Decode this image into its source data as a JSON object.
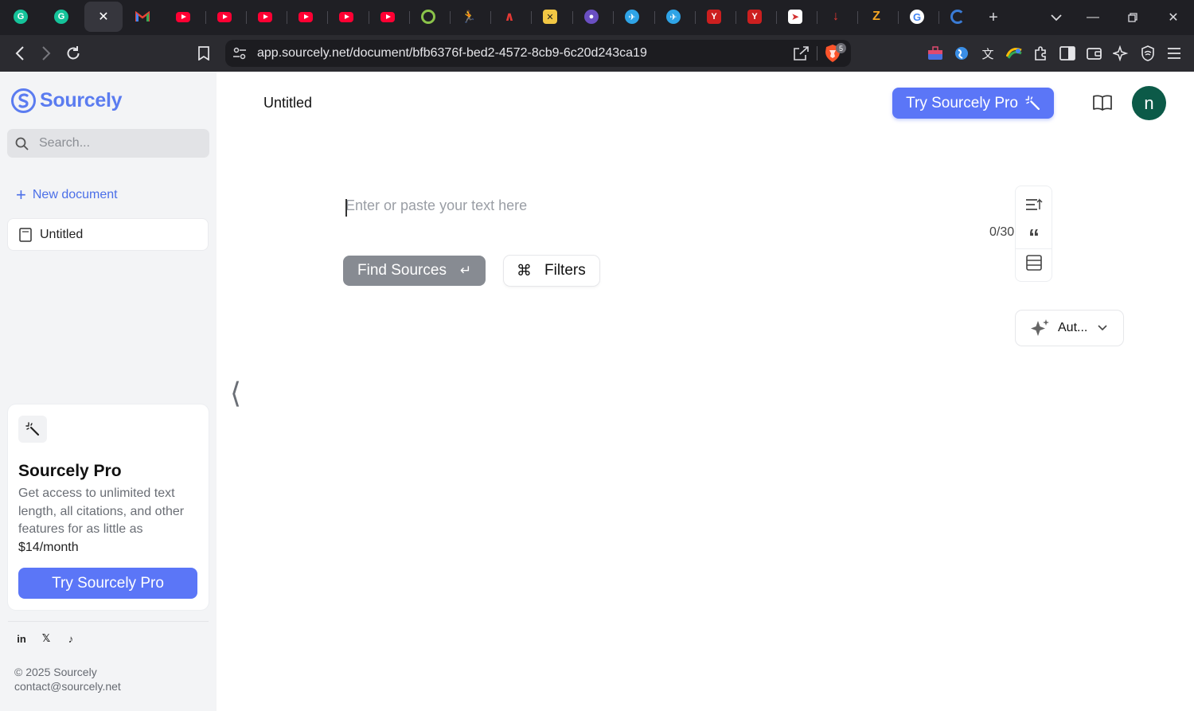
{
  "browser": {
    "url": "app.sourcely.net/document/bfb6376f-bed2-4572-8cb9-6c20d243ca19",
    "shields_count": "5",
    "tabs": [
      {
        "icon": "grammarly-icon"
      },
      {
        "icon": "grammarly-icon"
      },
      {
        "icon": "close-icon",
        "active": true
      },
      {
        "icon": "gmail-icon"
      },
      {
        "icon": "youtube-icon"
      },
      {
        "icon": "youtube-icon"
      },
      {
        "icon": "youtube-icon"
      },
      {
        "icon": "youtube-icon"
      },
      {
        "icon": "youtube-icon"
      },
      {
        "icon": "youtube-icon"
      },
      {
        "icon": "ring-icon"
      },
      {
        "icon": "runner-icon"
      },
      {
        "icon": "pen-icon"
      },
      {
        "icon": "puzzle-app-icon"
      },
      {
        "icon": "globe-icon"
      },
      {
        "icon": "bird-icon"
      },
      {
        "icon": "bird-icon"
      },
      {
        "icon": "yale-icon"
      },
      {
        "icon": "yale-icon"
      },
      {
        "icon": "bird-red-icon"
      },
      {
        "icon": "download-arrow-icon"
      },
      {
        "icon": "z-icon"
      },
      {
        "icon": "google-icon"
      },
      {
        "icon": "edge-icon"
      }
    ],
    "colors": {
      "tabstrip": "#1f1f24",
      "toolbar": "#2b2b30",
      "youtube": "#ff0033"
    }
  },
  "sidebar": {
    "brand": "Sourcely",
    "search_placeholder": "Search...",
    "new_document": "New document",
    "documents": [
      "Untitled"
    ],
    "pro_card": {
      "title": "Sourcely Pro",
      "description": "Get access to unlimited text length, all citations, and other features for as little as",
      "price": "$14/month",
      "button": "Try Sourcely Pro"
    },
    "socials": [
      {
        "label": "in",
        "icon": "linkedin-icon"
      },
      {
        "label": "𝕏",
        "icon": "x-icon"
      },
      {
        "label": "♪",
        "icon": "tiktok-icon"
      }
    ],
    "copyright": "© 2025 Sourcely",
    "contact": "contact@sourcely.net"
  },
  "main": {
    "doc_title": "Untitled",
    "try_pro_button": "Try Sourcely Pro",
    "avatar_initial": "n",
    "editor_placeholder": "Enter or paste your text here",
    "counter_visible": "0/30",
    "counter_tail": ":",
    "find_sources": "Find Sources",
    "enter_glyph": "↵",
    "filters": "Filters",
    "cmd_glyph": "⌘",
    "mode_select": "Aut...",
    "collapse_glyph": "⟨",
    "colors": {
      "accent": "#5b76f7",
      "avatar": "#0c5a48",
      "brand": "#5b7cf0",
      "find_button": "#878b92"
    }
  }
}
